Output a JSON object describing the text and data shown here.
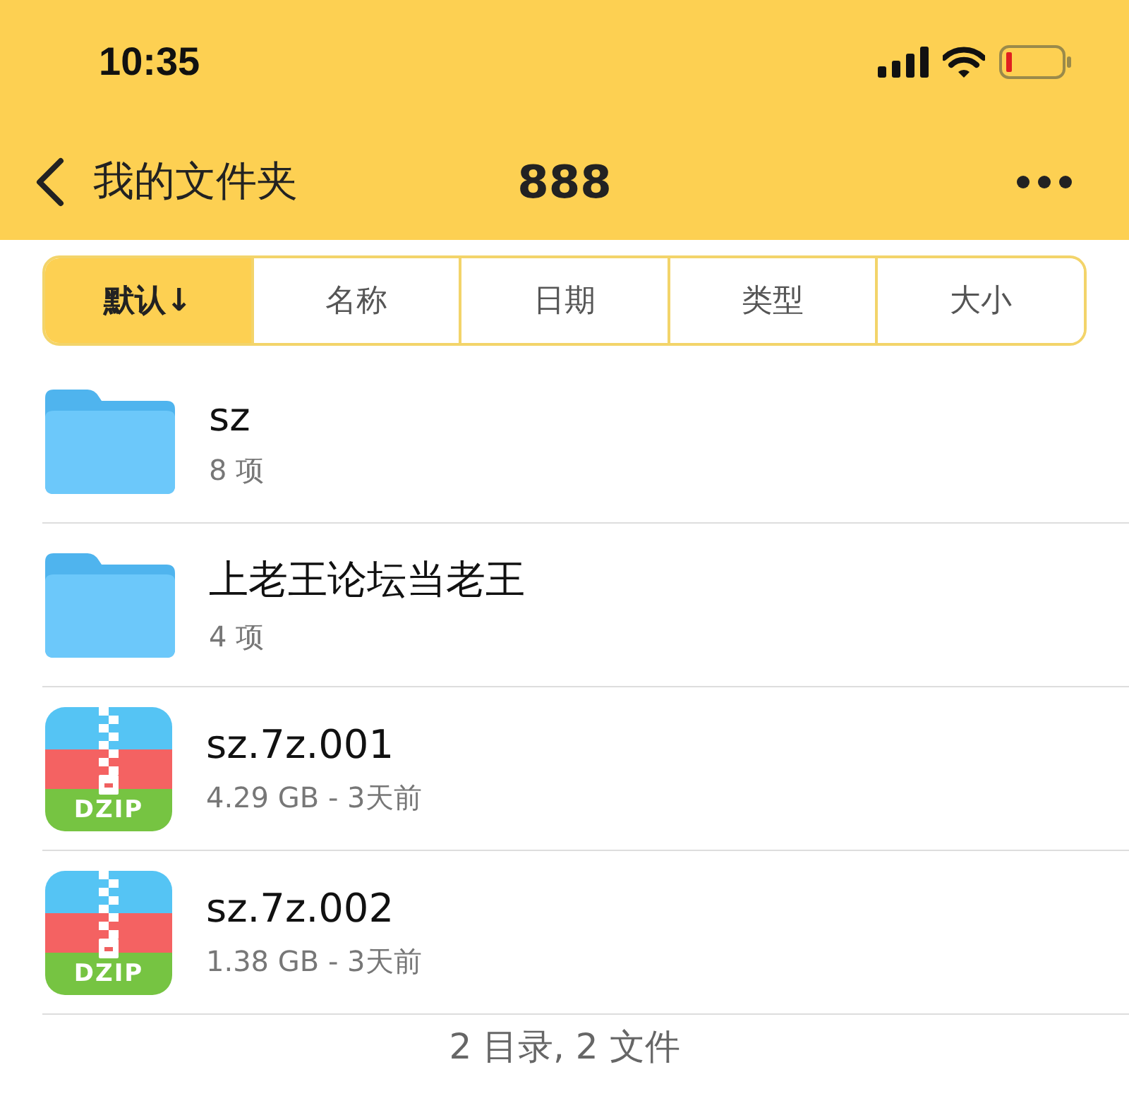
{
  "status_bar": {
    "time": "10:35"
  },
  "nav": {
    "back_label": "我的文件夹",
    "title": "888"
  },
  "sort_tabs": [
    {
      "label": "默认↓",
      "selected": true
    },
    {
      "label": "名称",
      "selected": false
    },
    {
      "label": "日期",
      "selected": false
    },
    {
      "label": "类型",
      "selected": false
    },
    {
      "label": "大小",
      "selected": false
    }
  ],
  "items": [
    {
      "kind": "folder",
      "name": "sz",
      "detail": "8 项"
    },
    {
      "kind": "folder",
      "name": "上老王论坛当老王",
      "detail": "4 项"
    },
    {
      "kind": "archive",
      "name": "sz.7z.001",
      "detail": "4.29 GB - 3天前",
      "icon_label": "DZIP"
    },
    {
      "kind": "archive",
      "name": "sz.7z.002",
      "detail": "1.38 GB - 3天前",
      "icon_label": "DZIP"
    }
  ],
  "footer": "2 目录, 2 文件"
}
